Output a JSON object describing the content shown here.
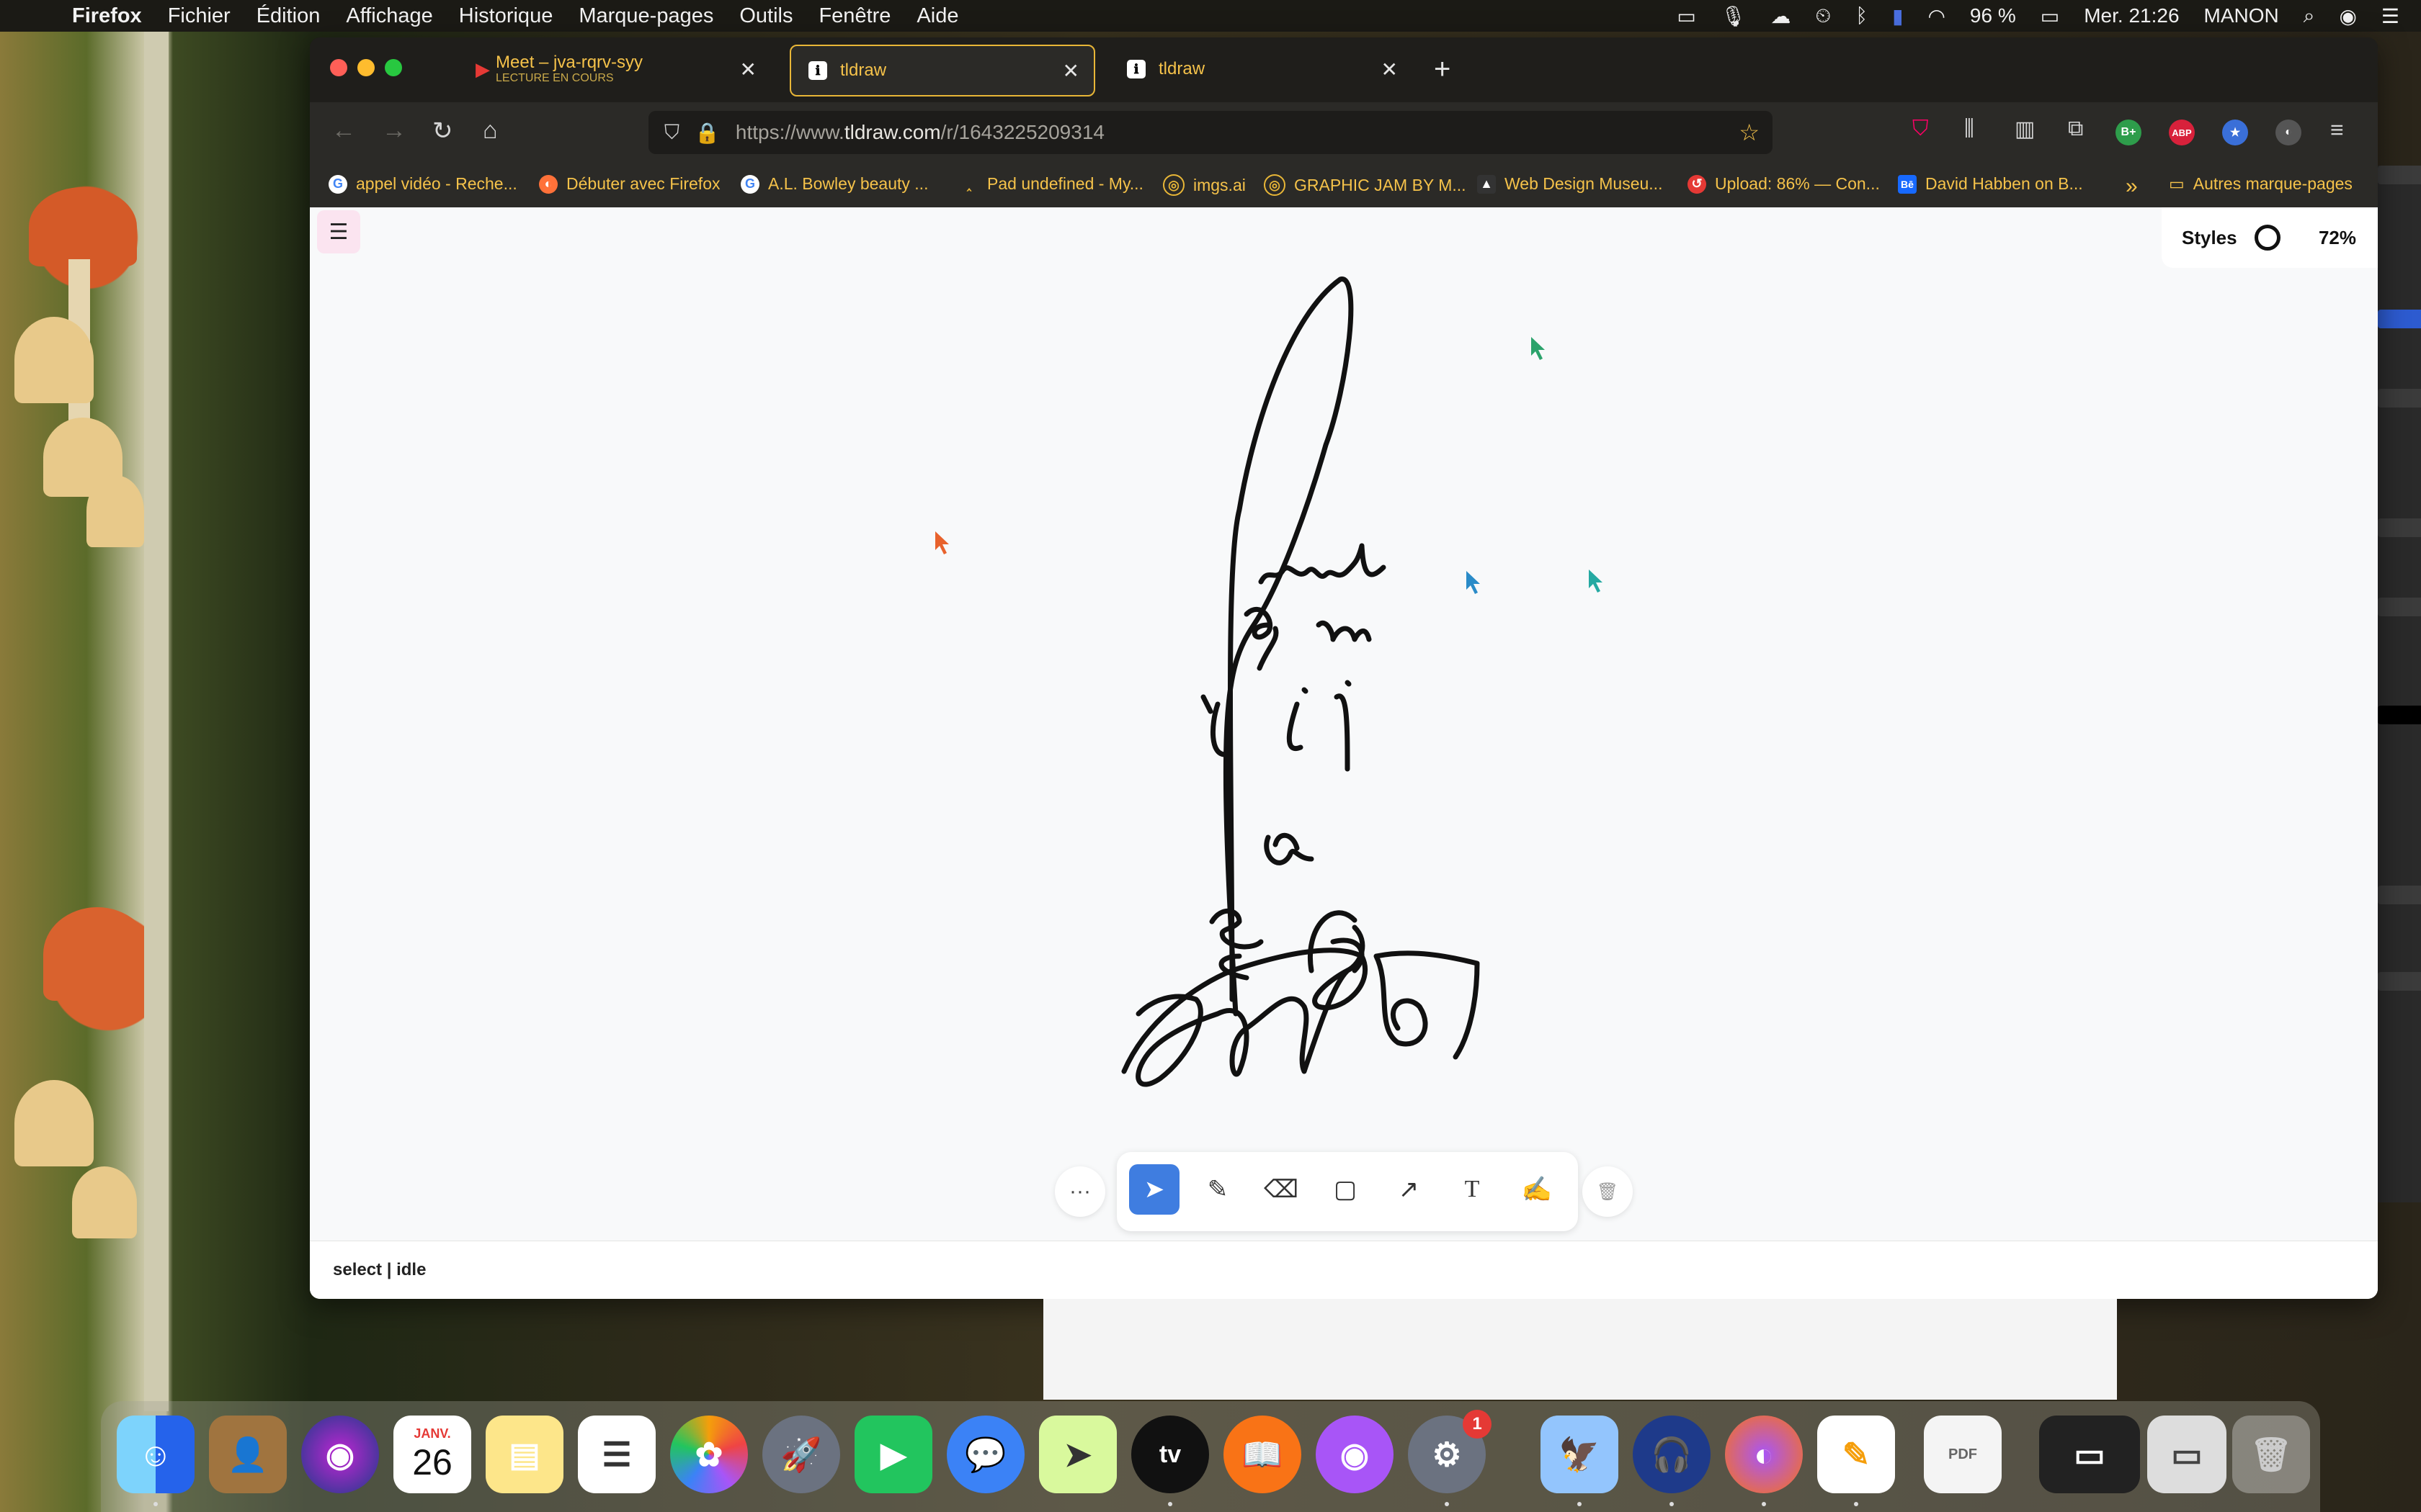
{
  "menubar": {
    "apple_glyph": "",
    "app": "Firefox",
    "items": [
      "Fichier",
      "Édition",
      "Affichage",
      "Historique",
      "Marque-pages",
      "Outils",
      "Fenêtre",
      "Aide"
    ],
    "battery": "96 %",
    "clock": "Mer. 21:26",
    "user": "MANON"
  },
  "browser": {
    "tabs": [
      {
        "title": "Meet – jva-rqrv-syy",
        "subtitle": "LECTURE EN COURS"
      },
      {
        "title": "tldraw"
      },
      {
        "title": "tldraw"
      }
    ],
    "new_tab_glyph": "+",
    "url_prefix": "https://www.",
    "url_domain": "tldraw.com",
    "url_path": "/r/1643225209314",
    "toolbar_badges": {
      "b_plus": "B+",
      "abp": "ABP"
    },
    "bookmarks": [
      "appel vidéo - Reche...",
      "Débuter avec Firefox",
      "A.L. Bowley beauty ...",
      "Pad undefined - My...",
      "imgs.ai",
      "GRAPHIC JAM BY M...",
      "Web Design Museu...",
      "Upload: 86% — Con...",
      "David Habben on B...",
      "Autres marque-pages"
    ]
  },
  "tldraw": {
    "styles_label": "Styles",
    "zoom": "72%",
    "status": "select | idle",
    "tools": [
      "select-tool",
      "pencil-tool",
      "eraser-tool",
      "rectangle-tool",
      "arrow-tool",
      "text-tool",
      "sticky-note-tool"
    ],
    "more_glyph": "···"
  },
  "colors": {
    "accent": "#3f7de0",
    "tab_text": "#f5c24a",
    "canvas": "#f8f9fa",
    "menu_button": "#fbe4f0"
  },
  "dock": {
    "calendar_month": "JANV.",
    "calendar_day": "26",
    "badge_count": "1",
    "apps": [
      "Finder",
      "Contacts",
      "Siri",
      "Calendrier",
      "Notes",
      "Rappels",
      "Photos",
      "Launchpad",
      "FaceTime",
      "Messages",
      "Plans",
      "Apple TV",
      "Livres",
      "Podcasts",
      "Préférences Système",
      "Aperçu",
      "Audacity",
      "Firefox",
      "Pages",
      "Documents",
      "Fenêtres",
      "Corbeille"
    ]
  }
}
